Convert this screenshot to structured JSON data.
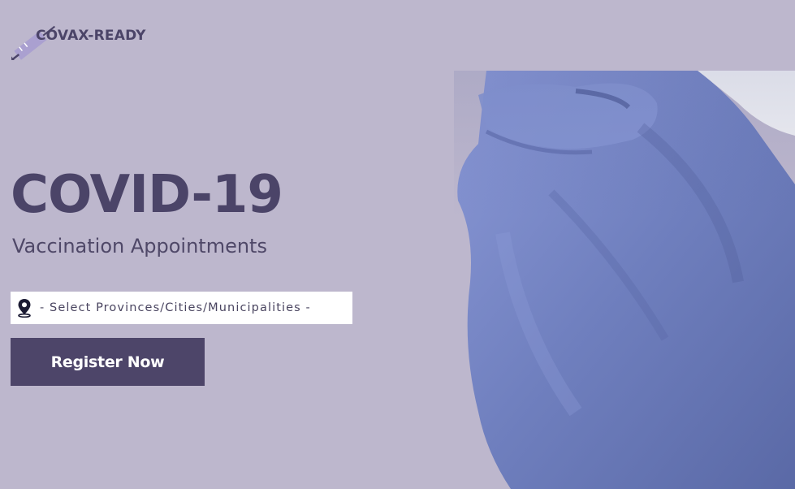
{
  "brand": {
    "name": "COVAX-READY",
    "icon": "syringe-icon",
    "color": "#4b4468",
    "accent": "#9f93c5"
  },
  "hero": {
    "title": "COVID-19",
    "subtitle": "Vaccination Appointments",
    "image": "gloved-hand-icon"
  },
  "location": {
    "icon": "map-pin-icon",
    "label": "- Select Provinces/Cities/Municipalities -"
  },
  "cta": {
    "label": "Register Now",
    "background": "#4d4569"
  },
  "colors": {
    "page_background": "#bdb7cd",
    "glove": "#6f7fbe"
  }
}
